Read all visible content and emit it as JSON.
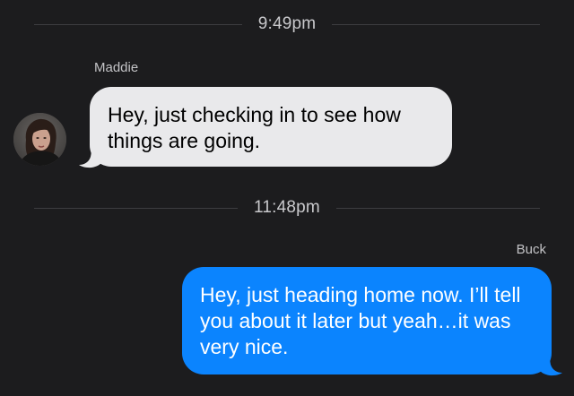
{
  "conversation": {
    "divider_1": {
      "time": "9:49pm"
    },
    "message_1": {
      "sender": "Maddie",
      "text": "Hey, just checking in to see how things are going."
    },
    "divider_2": {
      "time": "11:48pm"
    },
    "message_2": {
      "sender": "Buck",
      "text": "Hey, just heading home now. I’ll tell you about it later but yeah…it was very nice."
    }
  },
  "icons": {
    "avatar": "contact-photo-avatar"
  },
  "colors": {
    "background": "#1c1c1e",
    "incoming_bubble": "#e9e9eb",
    "outgoing_bubble": "#0b84fe",
    "timestamp_text": "#c9c9cc",
    "divider_line": "#3d3d40"
  }
}
